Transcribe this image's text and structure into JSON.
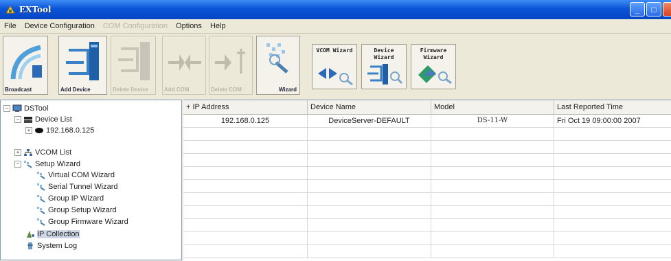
{
  "window": {
    "title": "EXTool"
  },
  "menu": [
    {
      "label": "File",
      "enabled": true
    },
    {
      "label": "Device Configuration",
      "enabled": true
    },
    {
      "label": "COM Configuration",
      "enabled": false
    },
    {
      "label": "Options",
      "enabled": true
    },
    {
      "label": "Help",
      "enabled": true
    }
  ],
  "toolbar": {
    "broadcast": "Broadcast",
    "add_device": "Add Device",
    "delete_device": "Delete Device",
    "add_com": "Add COM",
    "delete_com": "Delete COM",
    "wizard": "Wizard",
    "vcom_wizard": "VCOM Wizard",
    "device_wizard": "Device Wizard",
    "firmware_wizard": "Firmware Wizard"
  },
  "tree": {
    "root": "DSTool",
    "device_list": "Device List",
    "device_ip": "192.168.0.125",
    "vcom_list": "VCOM List",
    "setup_wizard": "Setup Wizard",
    "wizards": [
      "Virtual COM Wizard",
      "Serial Tunnel Wizard",
      "Group IP Wizard",
      "Group Setup Wizard",
      "Group Firmware Wizard"
    ],
    "ip_collection": "IP Collection",
    "system_log": "System Log"
  },
  "table": {
    "columns": [
      "+ IP Address",
      "Device Name",
      "Model",
      "Last Reported Time"
    ],
    "rows": [
      [
        "192.168.0.125",
        "DeviceServer-DEFAULT",
        "DS-11-W",
        "Fri Oct 19 09:00:00 2007"
      ]
    ]
  },
  "colors": {
    "titlebar": "#0a55d8",
    "selection": "#cfd6e6"
  }
}
